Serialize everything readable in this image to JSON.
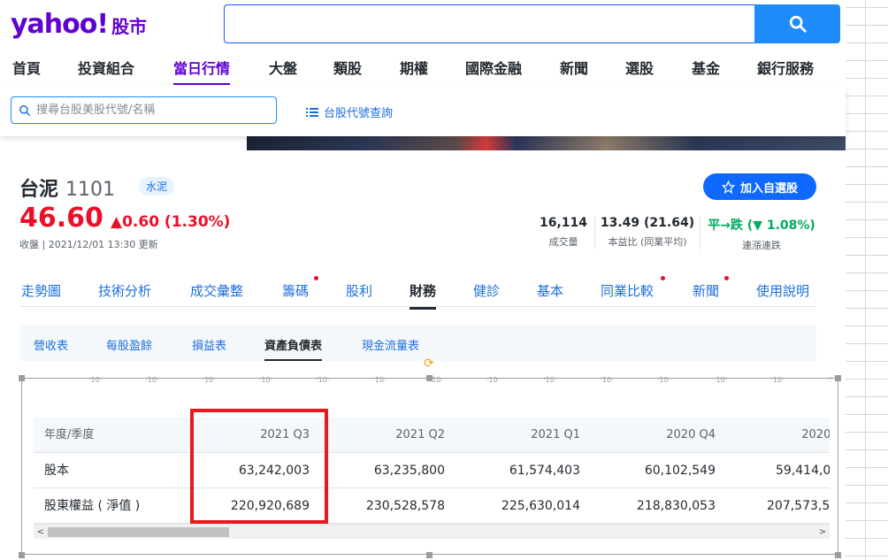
{
  "header": {
    "logo_text": "yahoo!",
    "logo_sub": "股市",
    "search_placeholder": ""
  },
  "nav": {
    "items": [
      "首頁",
      "投資組合",
      "當日行情",
      "大盤",
      "類股",
      "期權",
      "國際金融",
      "新聞",
      "選股",
      "基金",
      "銀行服務"
    ],
    "active_index": 2
  },
  "subbar": {
    "stock_search_placeholder": "搜尋台股美股代號/名稱",
    "code_lookup_label": "台股代號查詢"
  },
  "quote": {
    "name": "台泥",
    "code": "1101",
    "sector_tag": "水泥",
    "follow_label": "加入自選股",
    "price": "46.60",
    "change": "▲0.60 (1.30%)",
    "updated": "收盤 | 2021/12/01 13:30 更新",
    "stats": [
      {
        "value": "16,114",
        "label": "成交量"
      },
      {
        "value": "13.49 (21.64)",
        "label": "本益比 (同業平均)"
      },
      {
        "value": "平→跌 (▼ 1.08%)",
        "label": "連漲連跌"
      }
    ],
    "colors": {
      "up": "#eb0f29",
      "down": "#00ab5e",
      "brand": "#6001d2",
      "link": "#1d6fe0"
    }
  },
  "tabs": {
    "items": [
      "走勢圖",
      "技術分析",
      "成交彙整",
      "籌碼",
      "股利",
      "財務",
      "健診",
      "基本",
      "同業比較",
      "新聞",
      "使用說明"
    ],
    "active_index": 5
  },
  "subtabs": {
    "items": [
      "營收表",
      "每股盈餘",
      "損益表",
      "資產負債表",
      "現金流量表"
    ],
    "active_index": 3
  },
  "table": {
    "headers": [
      "年度/季度",
      "2021 Q3",
      "2021 Q2",
      "2021 Q1",
      "2020 Q4",
      "2020 Q3"
    ],
    "rows": [
      {
        "label": "股本",
        "values": [
          "63,242,003",
          "63,235,800",
          "61,574,403",
          "60,102,549",
          "59,414,0"
        ]
      },
      {
        "label": "股東權益 ( 淨值 )",
        "values": [
          "220,920,689",
          "230,528,578",
          "225,630,014",
          "218,830,053",
          "207,573,5"
        ]
      }
    ]
  },
  "scrollbar": {
    "left_arrow": "<",
    "right_arrow": ">"
  },
  "frame": {
    "tick_label": "·10·"
  }
}
